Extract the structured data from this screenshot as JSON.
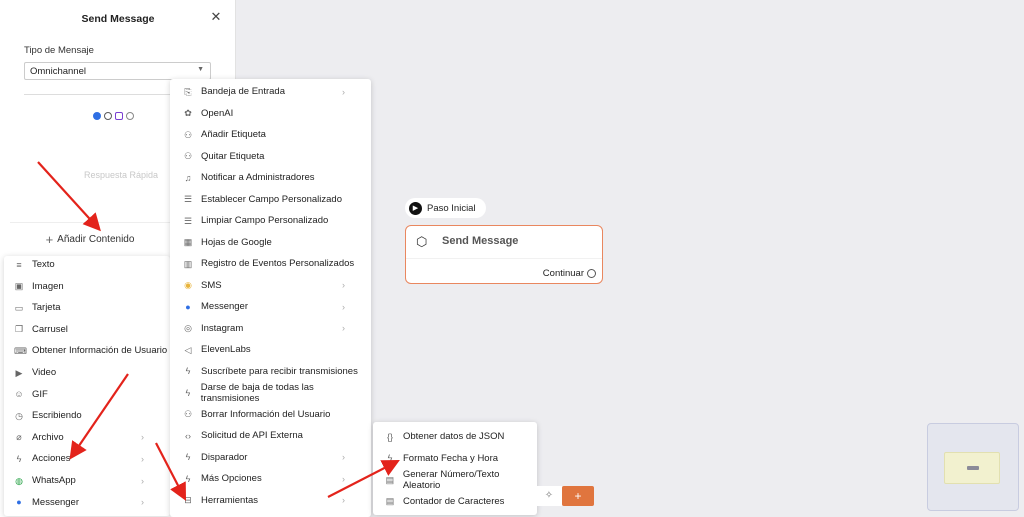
{
  "panel": {
    "title": "Send Message",
    "field_label": "Tipo de Mensaje",
    "select_value": "Omnichannel",
    "placeholder": "Respuesta Rápida",
    "add_content": "Añadir Contenido"
  },
  "menu1": [
    {
      "label": "Texto",
      "icon": "text-lines-icon",
      "glyph": "≡"
    },
    {
      "label": "Imagen",
      "icon": "image-icon",
      "glyph": "▣"
    },
    {
      "label": "Tarjeta",
      "icon": "card-icon",
      "glyph": "▭"
    },
    {
      "label": "Carrusel",
      "icon": "carousel-icon",
      "glyph": "❐"
    },
    {
      "label": "Obtener Información de Usuario",
      "icon": "keyboard-icon",
      "glyph": "⌨"
    },
    {
      "label": "Video",
      "icon": "video-icon",
      "glyph": "▶"
    },
    {
      "label": "GIF",
      "icon": "gif-icon",
      "glyph": "☺"
    },
    {
      "label": "Escribiendo",
      "icon": "clock-icon",
      "glyph": "◷"
    },
    {
      "label": "Archivo",
      "icon": "paperclip-icon",
      "glyph": "⌀",
      "arrow": true
    },
    {
      "label": "Acciones",
      "icon": "bolt-icon",
      "glyph": "ϟ",
      "arrow": true
    },
    {
      "label": "WhatsApp",
      "icon": "whatsapp-icon",
      "glyph": "◍",
      "arrow": true,
      "color": "#25a244"
    },
    {
      "label": "Messenger",
      "icon": "messenger-icon",
      "glyph": "●",
      "arrow": true,
      "color": "#2f6fe4"
    }
  ],
  "menu2": [
    {
      "label": "Bandeja de Entrada",
      "icon": "inbox-icon",
      "glyph": "⎘",
      "arrow": true
    },
    {
      "label": "OpenAI",
      "icon": "openai-icon",
      "glyph": "✿"
    },
    {
      "label": "Añadir Etiqueta",
      "icon": "user-tag-icon",
      "glyph": "⚇"
    },
    {
      "label": "Quitar Etiqueta",
      "icon": "user-untag-icon",
      "glyph": "⚇"
    },
    {
      "label": "Notificar a Administradores",
      "icon": "bell-icon",
      "glyph": "♫"
    },
    {
      "label": "Establecer Campo Personalizado",
      "icon": "database-icon",
      "glyph": "☰"
    },
    {
      "label": "Limpiar Campo Personalizado",
      "icon": "database-clear-icon",
      "glyph": "☰"
    },
    {
      "label": "Hojas de Google",
      "icon": "sheets-icon",
      "glyph": "▦"
    },
    {
      "label": "Registro de Eventos Personalizados",
      "icon": "chart-icon",
      "glyph": "▥"
    },
    {
      "label": "SMS",
      "icon": "sms-icon",
      "glyph": "◉",
      "arrow": true,
      "color": "#e8b43c"
    },
    {
      "label": "Messenger",
      "icon": "messenger-icon",
      "glyph": "●",
      "arrow": true,
      "color": "#2f6fe4"
    },
    {
      "label": "Instagram",
      "icon": "instagram-icon",
      "glyph": "◎",
      "arrow": true
    },
    {
      "label": "ElevenLabs",
      "icon": "speaker-icon",
      "glyph": "◁"
    },
    {
      "label": "Suscríbete para recibir transmisiones",
      "icon": "bolt-icon",
      "glyph": "ϟ"
    },
    {
      "label": "Darse de baja de todas las transmisiones",
      "icon": "bolt-icon",
      "glyph": "ϟ"
    },
    {
      "label": "Borrar Información del Usuario",
      "icon": "user-remove-icon",
      "glyph": "⚇"
    },
    {
      "label": "Solicitud de API Externa",
      "icon": "code-icon",
      "glyph": "‹›"
    },
    {
      "label": "Disparador",
      "icon": "bolt-icon",
      "glyph": "ϟ",
      "arrow": true
    },
    {
      "label": "Más Opciones",
      "icon": "bolt-icon",
      "glyph": "ϟ",
      "arrow": true
    },
    {
      "label": "Herramientas",
      "icon": "toolbox-icon",
      "glyph": "⊟",
      "arrow": true
    }
  ],
  "menu3": [
    {
      "label": "Obtener datos de JSON",
      "icon": "braces-icon",
      "glyph": "{}"
    },
    {
      "label": "Formato Fecha y Hora",
      "icon": "bolt-icon",
      "glyph": "ϟ"
    },
    {
      "label": "Generar Número/Texto Aleatorio",
      "icon": "dice-icon",
      "glyph": "▤"
    },
    {
      "label": "Contador de Caracteres",
      "icon": "counter-icon",
      "glyph": "▤"
    }
  ],
  "flow": {
    "start_label": "Paso Inicial",
    "node_title": "Send Message",
    "node_output": "Continuar"
  },
  "toolbar": {
    "add_label": "+"
  }
}
